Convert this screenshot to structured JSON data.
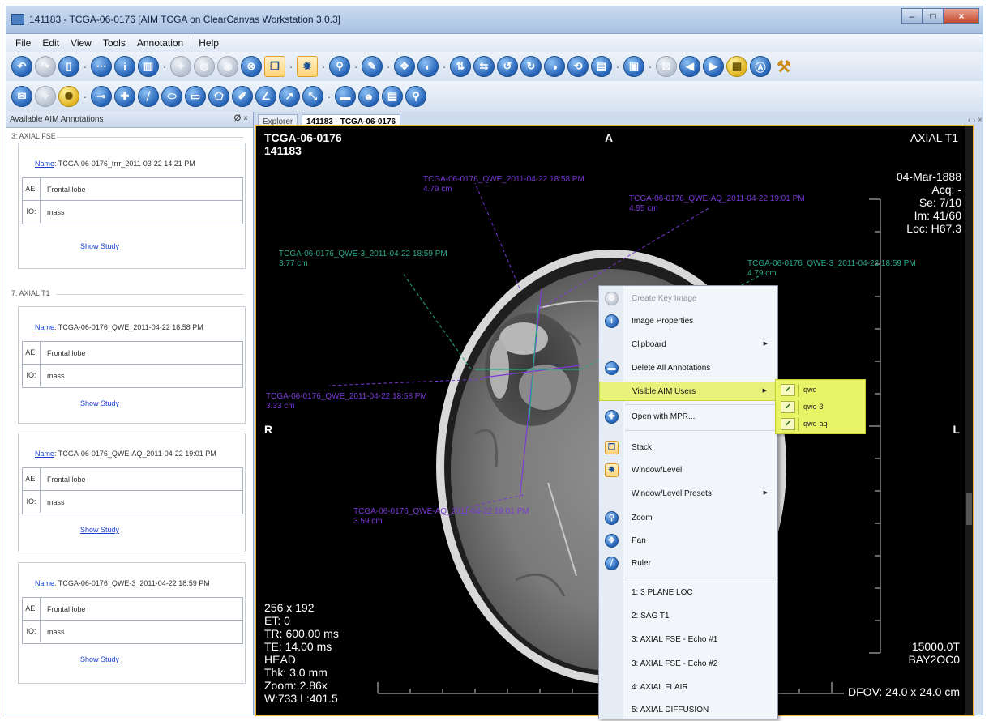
{
  "window": {
    "title": "141183 - TCGA-06-0176 [AIM TCGA on ClearCanvas Workstation 3.0.3]"
  },
  "menu": [
    "File",
    "Edit",
    "View",
    "Tools",
    "Annotation",
    "Help"
  ],
  "colors": {
    "accent_blue": "#2563b8",
    "viewer_border": "#e8b830",
    "highlight_yellow": "#e8f27a",
    "ann_purple": "#7a3ad6",
    "ann_teal": "#2aa88a"
  },
  "panel": {
    "title": "Available AIM Annotations",
    "header_buttons": "ⵁ ×",
    "groups": [
      {
        "label": "3: AXIAL FSE",
        "cards": [
          {
            "name_label": "Name",
            "name_value": ": TCGA-06-0176_trrr_2011-03-22 14:21 PM",
            "ae": "Frontal lobe",
            "io": "mass"
          }
        ]
      },
      {
        "label": "7: AXIAL T1",
        "cards": [
          {
            "name_label": "Name",
            "name_value": ": TCGA-06-0176_QWE_2011-04-22 18:58 PM",
            "ae": "Frontal lobe",
            "io": "mass"
          },
          {
            "name_label": "Name",
            "name_value": ": TCGA-06-0176_QWE-AQ_2011-04-22 19:01 PM",
            "ae": "Frontal lobe",
            "io": "mass"
          },
          {
            "name_label": "Name",
            "name_value": ": TCGA-06-0176_QWE-3_2011-04-22 18:59 PM",
            "ae": "Frontal lobe",
            "io": "mass"
          }
        ]
      }
    ],
    "ae_key": "AE:",
    "io_key": "IO:",
    "show_study": "Show Study"
  },
  "tabs": [
    {
      "label": "Explorer",
      "active": false
    },
    {
      "label": "141183 - TCGA-06-0176",
      "active": true
    }
  ],
  "tab_nav": "‹ › ×",
  "viewer": {
    "top_left": [
      "TCGA-06-0176",
      "141183"
    ],
    "top_center": "A",
    "top_right": "AXIAL T1",
    "right_info": [
      "04-Mar-1888",
      "Acq: -",
      "Se: 7/10",
      "Im: 41/60",
      "Loc: H67.3"
    ],
    "left_orient": "R",
    "right_orient": "L",
    "bottom_left": [
      "256 x 192",
      "ET: 0",
      "TR: 600.00 ms",
      "TE: 14.00 ms",
      "HEAD",
      "Thk: 3.0 mm",
      "Zoom: 2.86x",
      "W:733 L:401.5"
    ],
    "bottom_right": [
      "15000.0T",
      "BAY2OC0"
    ],
    "dfov": "DFOV: 24.0 x 24.0 cm",
    "annotations": [
      {
        "text": "TCGA-06-0176_QWE_2011-04-22  18:58  PM",
        "measure": "4.79 cm",
        "color": "#7a3ad6"
      },
      {
        "text": "TCGA-06-0176_QWE-AQ_2011-04-22  19:01  PM",
        "measure": "4.95 cm",
        "color": "#7a3ad6"
      },
      {
        "text": "TCGA-06-0176_QWE-3_2011-04-22  18:59  PM",
        "measure": "3.77 cm",
        "color": "#2aa88a"
      },
      {
        "text": "TCGA-06-0176_QWE-3_2011-04-22  18:59  PM",
        "measure": "4.79 cm",
        "color": "#2aa88a"
      },
      {
        "text": "TCGA-06-0176_QWE_2011-04-22  18:58  PM",
        "measure": "3.33 cm",
        "color": "#7a3ad6"
      },
      {
        "text": "TCGA-06-0176_QWE-AQ_2011-04-22  19:01  PM",
        "measure": "3.59 cm",
        "color": "#7a3ad6"
      }
    ]
  },
  "context_menu": {
    "items": [
      {
        "label": "Create Key Image",
        "icon": "key-image-icon",
        "disabled": true
      },
      {
        "label": "Image Properties",
        "icon": "info-icon"
      },
      {
        "label": "Clipboard",
        "submenu": true
      },
      {
        "label": "Delete All Annotations",
        "icon": "delete-annotations-icon"
      },
      {
        "label": "Visible AIM Users",
        "submenu": true,
        "highlighted": true
      },
      {
        "label": "Open with MPR...",
        "icon": "mpr-icon"
      },
      {
        "label": "Stack",
        "icon": "stack-icon"
      },
      {
        "label": "Window/Level",
        "icon": "window-level-icon"
      },
      {
        "label": "Window/Level Presets",
        "submenu": true
      },
      {
        "label": "Zoom",
        "icon": "zoom-icon"
      },
      {
        "label": "Pan",
        "icon": "pan-icon"
      },
      {
        "label": "Ruler",
        "icon": "ruler-icon"
      },
      {
        "label": "1: 3 PLANE LOC"
      },
      {
        "label": "2: SAG T1"
      },
      {
        "label": "3: AXIAL FSE - Echo #1"
      },
      {
        "label": "3: AXIAL FSE - Echo #2"
      },
      {
        "label": "4: AXIAL FLAIR"
      },
      {
        "label": "5: AXIAL DIFFUSION"
      }
    ]
  },
  "submenu": {
    "users": [
      {
        "label": "qwe",
        "checked": true
      },
      {
        "label": "qwe-3",
        "checked": true
      },
      {
        "label": "qwe-aq",
        "checked": true
      }
    ],
    "check_glyph": "✔"
  }
}
